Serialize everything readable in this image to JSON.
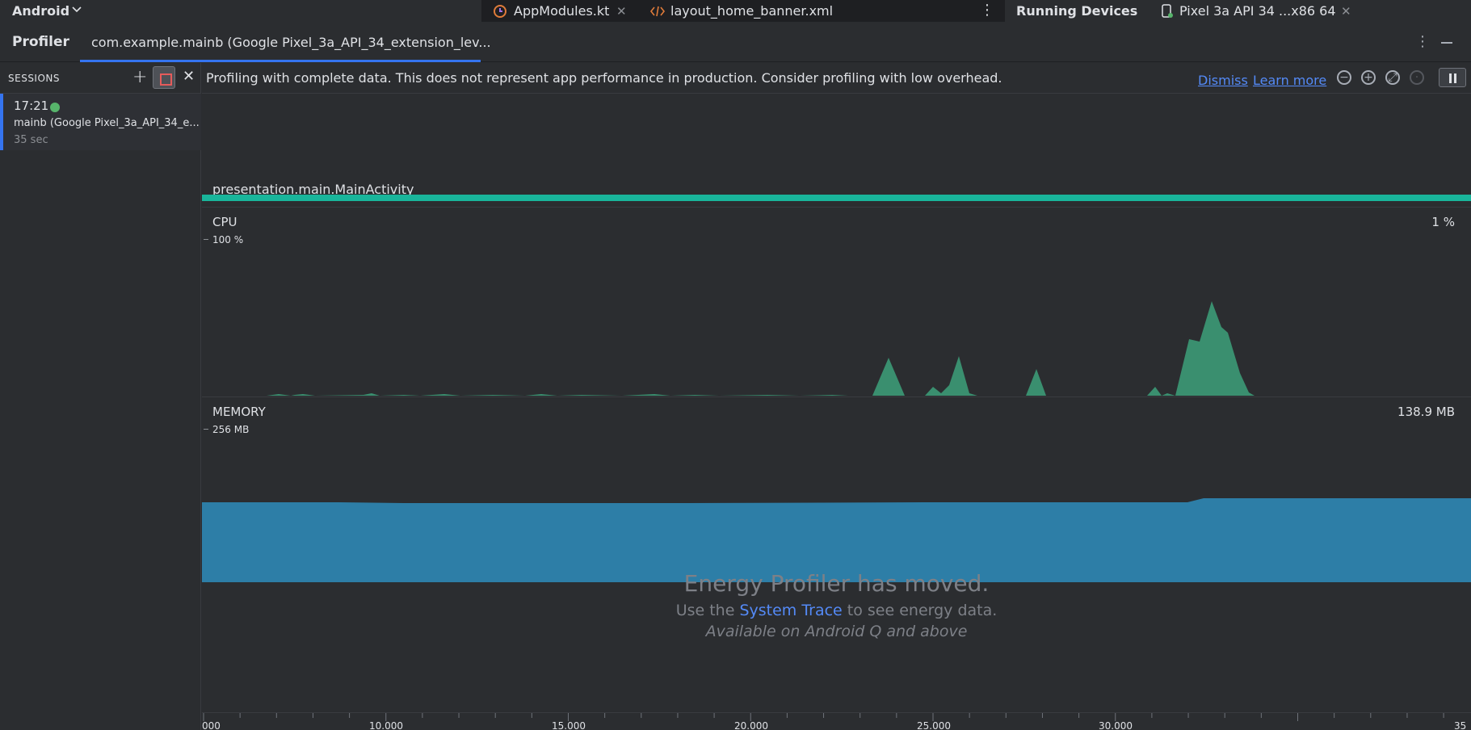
{
  "topbar": {
    "project": "Android",
    "tabs": [
      {
        "label": "AppModules.kt",
        "icon": "kotlin-file-icon"
      },
      {
        "label": "layout_home_banner.xml",
        "icon": "xml-file-icon"
      }
    ],
    "running_devices": "Running Devices",
    "device_tab": "Pixel 3a API 34 ...x86 64"
  },
  "profiler": {
    "title": "Profiler",
    "session_tab": "com.example.mainb (Google Pixel_3a_API_34_extension_lev..."
  },
  "sidebar": {
    "header": "SESSIONS",
    "session": {
      "time": "17:21",
      "name": "mainb (Google Pixel_3a_API_34_e...",
      "duration": "35 sec",
      "status_color": "#57b46b"
    }
  },
  "banner": {
    "text": "Profiling with complete data. This does not represent app performance in production. Consider profiling with low overhead.",
    "dismiss": "Dismiss",
    "learn_more": "Learn more"
  },
  "activity": {
    "label": "presentation.main.MainActivity",
    "color": "#19b59b"
  },
  "cpu": {
    "title": "CPU",
    "scale": "100 %",
    "value": "1 %",
    "color": "#3a8f6f"
  },
  "memory": {
    "title": "MEMORY",
    "scale": "256 MB",
    "value": "138.9 MB",
    "color": "#2d7ea7"
  },
  "energy": {
    "title": "Energy Profiler has moved.",
    "line_prefix": "Use the",
    "link": "System Trace",
    "line_suffix": "to see energy data.",
    "note": "Available on Android Q and above"
  },
  "timeline": {
    "labels": [
      "000",
      "10.000",
      "15.000",
      "20.000",
      "25.000",
      "30.000",
      "35"
    ]
  }
}
